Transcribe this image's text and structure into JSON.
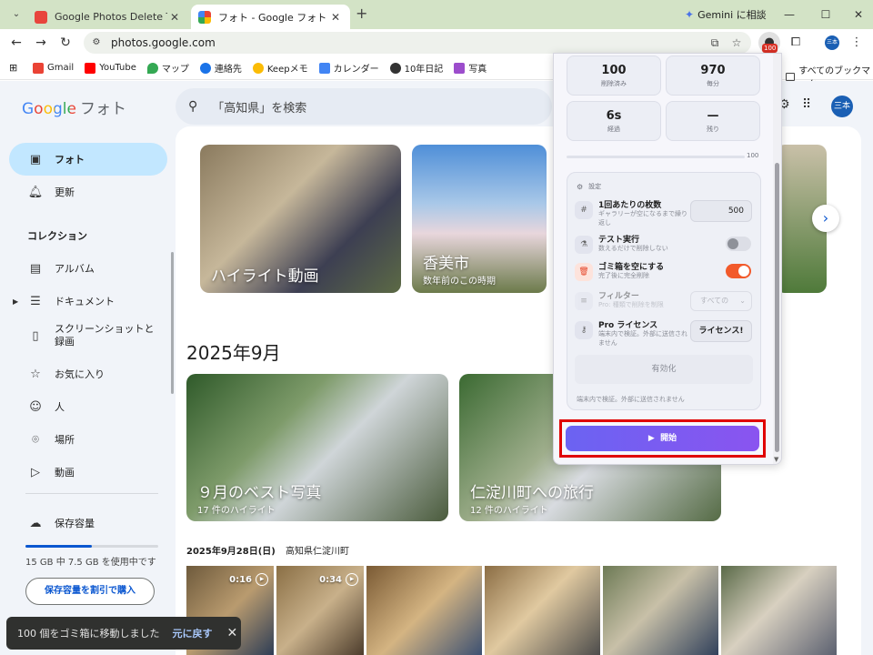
{
  "browser": {
    "tabs": [
      {
        "title": "Google Photos Delete Tool - Ch",
        "favicon_color": "#e8453c"
      },
      {
        "title": "フォト - Google フォト",
        "favicon_color": "#fbbc05"
      }
    ],
    "new_tab": "+",
    "gemini_label": "Gemini に相談",
    "url": "photos.google.com",
    "extension_badge": "100",
    "profile_initials": "三本",
    "bookmarks": [
      {
        "label": "Gmail",
        "color": "#ea4335"
      },
      {
        "label": "YouTube",
        "color": "#ff0000"
      },
      {
        "label": "マップ",
        "color": "#34a853"
      },
      {
        "label": "連絡先",
        "color": "#1a73e8"
      },
      {
        "label": "Keepメモ",
        "color": "#fbbc05"
      },
      {
        "label": "カレンダー",
        "color": "#4285f4"
      },
      {
        "label": "10年日記",
        "color": "#333333"
      },
      {
        "label": "写真",
        "color": "#9c4dcc"
      }
    ],
    "all_bookmarks": "すべてのブックマーク"
  },
  "photos": {
    "logo_google": "Google",
    "logo_photos": "フォト",
    "search_placeholder": "「高知県」を検索",
    "account_initials": "三本",
    "sidebar": {
      "photos": "フォト",
      "updates": "更新",
      "collections_heading": "コレクション",
      "albums": "アルバム",
      "documents": "ドキュメント",
      "screenshots": "スクリーンショットと録画",
      "favorites": "お気に入り",
      "people": "人",
      "places": "場所",
      "videos": "動画",
      "storage": "保存容量",
      "storage_used": "15 GB 中 7.5 GB を使用中です",
      "storage_fraction": 0.5,
      "buy_storage": "保存容量を割引で購入"
    },
    "highlights": [
      {
        "title": "ハイライト動画",
        "subtitle": ""
      },
      {
        "title": "香美市",
        "subtitle": "数年前のこの時期"
      }
    ],
    "section_title": "2025年9月",
    "memories": [
      {
        "title": "９月のベスト写真",
        "subtitle": "17 件のハイライト"
      },
      {
        "title": "仁淀川町への旅行",
        "subtitle": "12 件のハイライト"
      }
    ],
    "date_heading": "2025年9月28日(日)",
    "date_place": "高知県仁淀川町",
    "videos": [
      "0:16",
      "0:34"
    ]
  },
  "snackbar": {
    "message": "100 個をゴミ箱に移動しました",
    "undo": "元に戻す"
  },
  "extension": {
    "stats": [
      {
        "value": "100",
        "label": "削除済み"
      },
      {
        "value": "970",
        "label": "毎分"
      },
      {
        "value": "6s",
        "label": "経過"
      },
      {
        "value": "—",
        "label": "残り"
      }
    ],
    "progress_label": "100",
    "progress_fraction": 0.0,
    "settings_heading": "設定",
    "batch": {
      "title": "1回あたりの枚数",
      "sub": "ギャラリーが空になるまで繰り返し",
      "value": "500"
    },
    "dry_run": {
      "title": "テスト実行",
      "sub": "数えるだけで削除しない",
      "on": false
    },
    "empty_trash": {
      "title": "ゴミ箱を空にする",
      "sub": "完了後に完全削除",
      "on": true
    },
    "filter": {
      "title": "フィルター",
      "sub": "Pro: 種類で削除を制限",
      "value": "すべての"
    },
    "license": {
      "title": "Pro ライセンス",
      "sub": "端末内で検証。外部に送信されません",
      "button": "ライセンス!"
    },
    "activate": "有効化",
    "footer": "端末内で検証。外部に送信されません",
    "start": "開始",
    "accent": "#7b5cf0"
  }
}
